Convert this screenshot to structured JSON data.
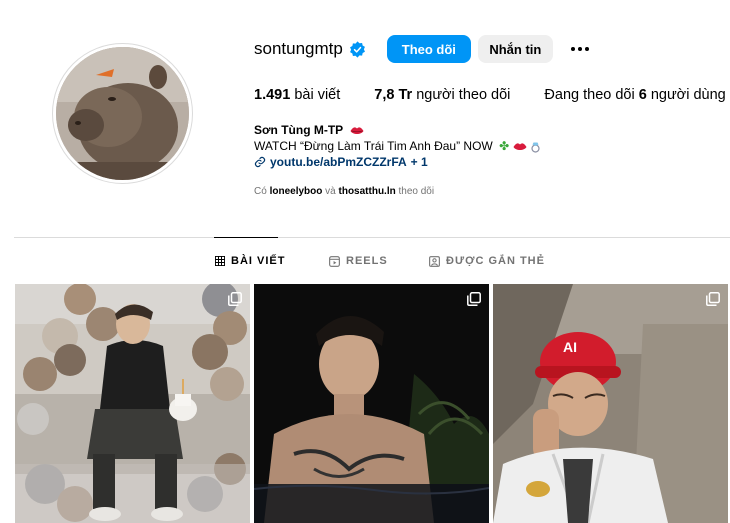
{
  "profile": {
    "username": "sontungmtp",
    "follow_label": "Theo dõi",
    "message_label": "Nhắn tin",
    "verified_color": "#0095f6",
    "avatar_icon": "capybara-photo"
  },
  "stats": {
    "posts_count": "1.491",
    "posts_label": "bài viết",
    "followers_count": "7,8 Tr",
    "followers_label": "người theo dõi",
    "following_prefix": "Đang theo dõi",
    "following_count": "6",
    "following_suffix": "người dùng"
  },
  "bio": {
    "name": "Sơn Tùng M-TP",
    "line": "WATCH “Đừng Làm Trái Tim Anh Đau” NOW",
    "link": "youtu.be/abPmZCZZrFA",
    "link_more": "+ 1"
  },
  "followed_by": {
    "prefix": "Có",
    "user1": "loneelyboo",
    "and": "và",
    "user2": "thosatthu.ln",
    "suffix": "theo dõi"
  },
  "tabs": [
    {
      "label": "BÀI VIẾT",
      "icon": "grid-icon",
      "active": true
    },
    {
      "label": "REELS",
      "icon": "reels-icon",
      "active": false
    },
    {
      "label": "ĐƯỢC GẮN THẺ",
      "icon": "tagged-icon",
      "active": false
    }
  ],
  "posts": [
    {
      "icon": "multi-photo-icon",
      "scene": "man-with-balloons-and-cake"
    },
    {
      "icon": "multi-photo-icon",
      "scene": "man-in-pool-at-night"
    },
    {
      "icon": "multi-photo-icon",
      "scene": "man-with-red-cap-in-car"
    }
  ]
}
